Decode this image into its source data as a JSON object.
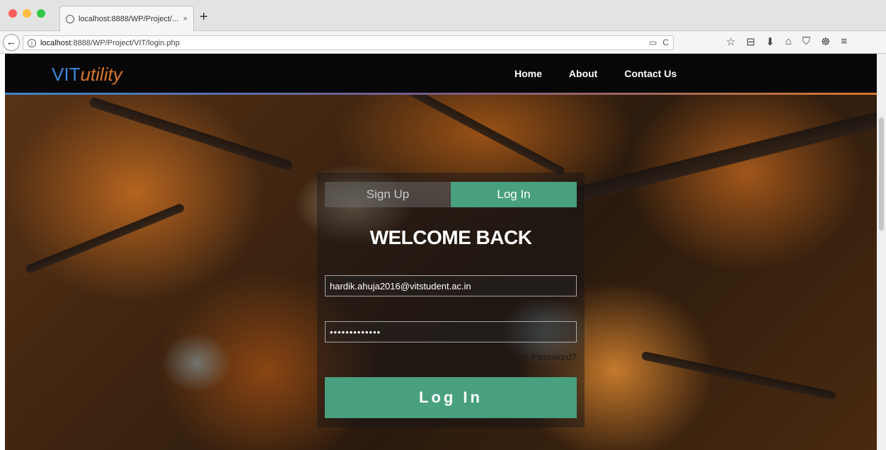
{
  "browser": {
    "tab_title": "localhost:8888/WP/Project/...",
    "tab_close": "×",
    "new_tab": "+",
    "url_host": "localhost",
    "url_rest": ":8888/WP/Project/VIT/login.php",
    "back": "←",
    "info": "i",
    "reader_icon": "▭",
    "reload_icon": "C",
    "toolbar": {
      "bookmark_star": "☆",
      "library": "⊟",
      "download": "⬇",
      "home": "⌂",
      "pocket": "⛉",
      "extension": "☸",
      "menu": "≡"
    }
  },
  "site": {
    "logo_main": "VIT",
    "logo_sub": "utility",
    "nav": [
      "Home",
      "About",
      "Contact Us"
    ]
  },
  "login": {
    "tab_signup": "Sign Up",
    "tab_login": "Log In",
    "heading": "WELCOME BACK",
    "email_value": "hardik.ahuja2016@vitstudent.ac.in",
    "password_value": "•••••••••••••",
    "forgot": "Forgot Password?",
    "submit": "Log In"
  },
  "colors": {
    "accent_green": "#48a07f",
    "logo_blue": "#3b86d6",
    "logo_orange": "#d9762a",
    "header_black": "#070707"
  }
}
